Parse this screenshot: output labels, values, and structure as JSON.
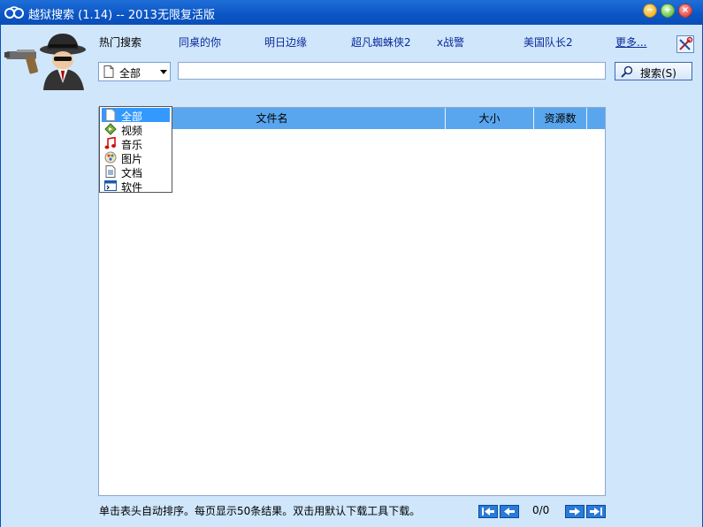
{
  "window": {
    "title": "越狱搜索 (1.14) -- 2013无限复活版"
  },
  "hot_search": {
    "label": "热门搜索",
    "links": [
      "同桌的你",
      "明日边缘",
      "超凡蜘蛛侠2",
      "x战警",
      "美国队长2"
    ],
    "more": "更多..."
  },
  "search": {
    "category_selected": "全部",
    "query": "",
    "button_label": "搜索(S)"
  },
  "category_menu": {
    "items": [
      {
        "label": "全部",
        "icon": "document-icon",
        "selected": true
      },
      {
        "label": "视频",
        "icon": "video-icon",
        "selected": false
      },
      {
        "label": "音乐",
        "icon": "music-note-icon",
        "selected": false
      },
      {
        "label": "图片",
        "icon": "picture-icon",
        "selected": false
      },
      {
        "label": "文档",
        "icon": "text-document-icon",
        "selected": false
      },
      {
        "label": "软件",
        "icon": "software-icon",
        "selected": false
      }
    ]
  },
  "results_table": {
    "columns": [
      "文件名",
      "大小",
      "资源数"
    ],
    "rows": []
  },
  "status": {
    "hint": "单击表头自动排序。每页显示50条结果。双击用默认下载工具下载。",
    "page": "0/0"
  },
  "colors": {
    "titlebar": "#0b55c5",
    "background": "#cfe6fb",
    "table_header": "#5aa6ee",
    "selection": "#3399ff"
  }
}
